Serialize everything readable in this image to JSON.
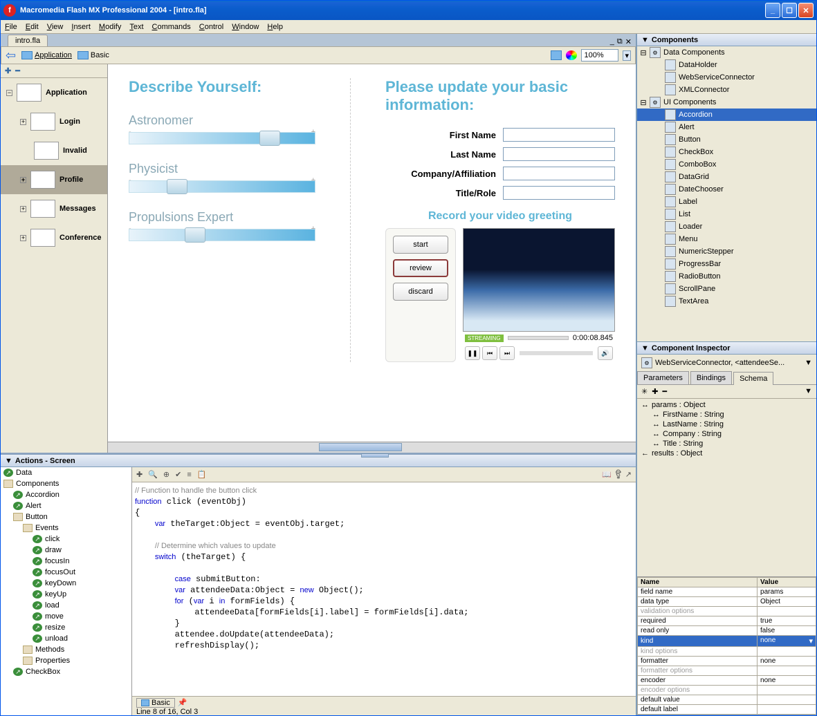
{
  "title": "Macromedia Flash MX Professional 2004  -  [intro.fla]",
  "menu": [
    "File",
    "Edit",
    "View",
    "Insert",
    "Modify",
    "Text",
    "Commands",
    "Control",
    "Window",
    "Help"
  ],
  "docTab": "intro.fla",
  "breadcrumb": {
    "back": "⇦",
    "items": [
      "Application",
      "Basic"
    ],
    "zoom": "100%"
  },
  "navTree": [
    {
      "label": "Application",
      "indent": 0
    },
    {
      "label": "Login",
      "indent": 1
    },
    {
      "label": "Invalid",
      "indent": 2
    },
    {
      "label": "Profile",
      "indent": 1,
      "selected": true
    },
    {
      "label": "Messages",
      "indent": 1
    },
    {
      "label": "Conference",
      "indent": 1
    }
  ],
  "canvas": {
    "h1a": "Describe Yourself:",
    "h1b": "Please update your basic information:",
    "sliders": [
      {
        "label": "Astronomer",
        "pos": 70
      },
      {
        "label": "Physicist",
        "pos": 20
      },
      {
        "label": "Propulsions Expert",
        "pos": 30
      }
    ],
    "fields": [
      "First Name",
      "Last Name",
      "Company/Affiliation",
      "Title/Role"
    ],
    "videoHead": "Record your video greeting",
    "videoBtns": [
      "start",
      "review",
      "discard"
    ],
    "streaming": "STREAMING",
    "time": "0:00:08.845"
  },
  "actionsPanel": {
    "title": "Actions - Screen",
    "tree": [
      {
        "l": "Data",
        "i": 0,
        "ico": "arrow"
      },
      {
        "l": "Components",
        "i": 0,
        "ico": "book"
      },
      {
        "l": "Accordion",
        "i": 1,
        "ico": "arrow"
      },
      {
        "l": "Alert",
        "i": 1,
        "ico": "arrow"
      },
      {
        "l": "Button",
        "i": 1,
        "ico": "book"
      },
      {
        "l": "Events",
        "i": 2,
        "ico": "book"
      },
      {
        "l": "click",
        "i": 3,
        "ico": "arrow"
      },
      {
        "l": "draw",
        "i": 3,
        "ico": "arrow"
      },
      {
        "l": "focusIn",
        "i": 3,
        "ico": "arrow"
      },
      {
        "l": "focusOut",
        "i": 3,
        "ico": "arrow"
      },
      {
        "l": "keyDown",
        "i": 3,
        "ico": "arrow"
      },
      {
        "l": "keyUp",
        "i": 3,
        "ico": "arrow"
      },
      {
        "l": "load",
        "i": 3,
        "ico": "arrow"
      },
      {
        "l": "move",
        "i": 3,
        "ico": "arrow"
      },
      {
        "l": "resize",
        "i": 3,
        "ico": "arrow"
      },
      {
        "l": "unload",
        "i": 3,
        "ico": "arrow"
      },
      {
        "l": "Methods",
        "i": 2,
        "ico": "book"
      },
      {
        "l": "Properties",
        "i": 2,
        "ico": "book"
      },
      {
        "l": "CheckBox",
        "i": 1,
        "ico": "arrow"
      }
    ],
    "code": "// Function to handle the button click\nfunction click (eventObj)\n{\n    var theTarget:Object = eventObj.target;\n\n    // Determine which values to update\n    switch (theTarget) {\n\n        case submitButton:\n        var attendeeData:Object = new Object();\n        for (var i in formFields) {\n            attendeeData[formFields[i].label] = formFields[i].data;\n        }\n        attendee.doUpdate(attendeeData);\n        refreshDisplay();",
    "statusTab": "Basic",
    "status": "Line 8 of 16, Col 3"
  },
  "componentsPanel": {
    "title": "Components",
    "groups": [
      {
        "label": "Data Components",
        "items": [
          "DataHolder",
          "WebServiceConnector",
          "XMLConnector"
        ]
      },
      {
        "label": "UI Components",
        "items": [
          "Accordion",
          "Alert",
          "Button",
          "CheckBox",
          "ComboBox",
          "DataGrid",
          "DateChooser",
          "Label",
          "List",
          "Loader",
          "Menu",
          "NumericStepper",
          "ProgressBar",
          "RadioButton",
          "ScrollPane",
          "TextArea"
        ]
      }
    ],
    "selected": "Accordion"
  },
  "inspector": {
    "title": "Component Inspector",
    "target": "WebServiceConnector, <attendeeSe...",
    "tabs": [
      "Parameters",
      "Bindings",
      "Schema"
    ],
    "activeTab": "Schema",
    "schema": [
      {
        "l": "params : Object",
        "i": 0,
        "a": "↔"
      },
      {
        "l": "FirstName : String",
        "i": 1,
        "a": "↔"
      },
      {
        "l": "LastName : String",
        "i": 1,
        "a": "↔"
      },
      {
        "l": "Company : String",
        "i": 1,
        "a": "↔"
      },
      {
        "l": "Title : String",
        "i": 1,
        "a": "↔"
      },
      {
        "l": "results : Object",
        "i": 0,
        "a": "←"
      }
    ],
    "propHead": [
      "Name",
      "Value"
    ],
    "props": [
      {
        "n": "field name",
        "v": "params"
      },
      {
        "n": "data type",
        "v": "Object"
      },
      {
        "n": "validation options",
        "v": "",
        "dis": true
      },
      {
        "n": "required",
        "v": "true"
      },
      {
        "n": "read only",
        "v": "false"
      },
      {
        "n": "kind",
        "v": "none",
        "sel": true
      },
      {
        "n": "kind options",
        "v": "",
        "dis": true
      },
      {
        "n": "formatter",
        "v": "none"
      },
      {
        "n": "formatter options",
        "v": "",
        "dis": true
      },
      {
        "n": "encoder",
        "v": "none"
      },
      {
        "n": "encoder options",
        "v": "",
        "dis": true
      },
      {
        "n": "default value",
        "v": ""
      },
      {
        "n": "default label",
        "v": ""
      }
    ]
  }
}
